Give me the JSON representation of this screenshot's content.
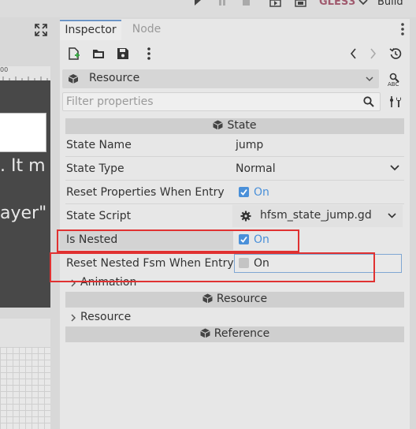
{
  "toolbar": {
    "renderer_label": "GLES3",
    "build_label": "Build"
  },
  "left_pane": {
    "ruler_number": "00",
    "text_line_1": ". It m",
    "text_line_2": "ayer\""
  },
  "inspector": {
    "tabs": [
      "Inspector",
      "Node"
    ],
    "resource_label": "Resource",
    "filter_placeholder": "Filter properties",
    "state_section": "State",
    "properties": {
      "state_name": {
        "label": "State Name",
        "value": "jump"
      },
      "state_type": {
        "label": "State Type",
        "value": "Normal"
      },
      "reset_properties": {
        "label": "Reset Properties When Entry",
        "value": "On"
      },
      "state_script": {
        "label": "State Script",
        "value": "hfsm_state_jump.gd"
      },
      "is_nested": {
        "label": "Is Nested",
        "value": "On"
      },
      "reset_nested": {
        "label": "Reset Nested Fsm When Entry",
        "value": "On"
      }
    },
    "animation_label": "Animation",
    "resource_section": "Resource",
    "resource_group": "Resource",
    "reference_section": "Reference"
  },
  "colors": {
    "accent": "#4a90d9",
    "highlight_red": "#e03131",
    "renderer": "#a05a6e"
  },
  "icons": [
    "play-icon",
    "pause-icon",
    "stop-icon",
    "movie-icon",
    "scene-icon",
    "expand-icon",
    "new-resource-icon",
    "open-folder-icon",
    "save-icon",
    "more-vert-icon",
    "back-icon",
    "forward-icon",
    "history-icon",
    "cube-icon",
    "object-tool-icon",
    "search-icon",
    "tool-settings-icon",
    "gear-icon",
    "chevron-down-icon",
    "chevron-right-icon"
  ]
}
